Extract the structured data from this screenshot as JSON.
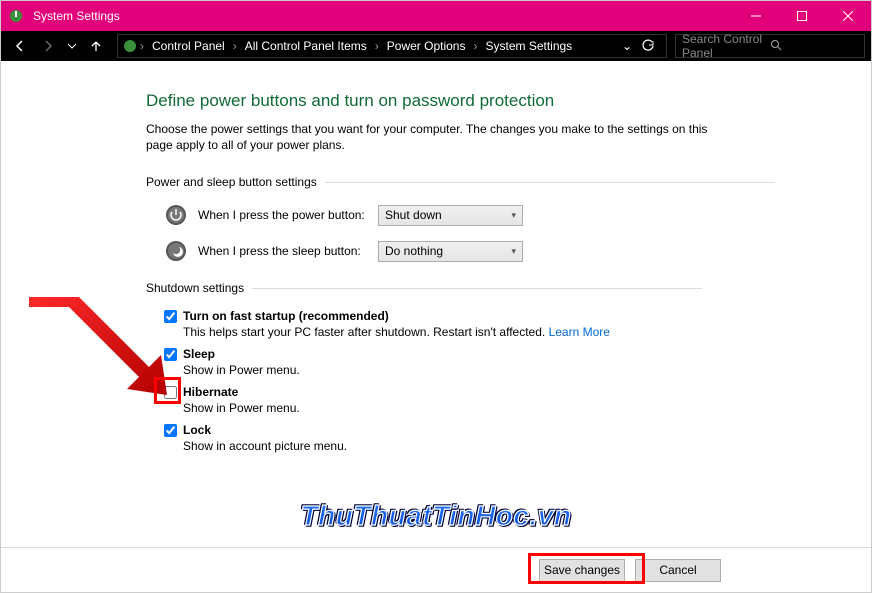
{
  "window": {
    "title": "System Settings"
  },
  "breadcrumbs": {
    "items": [
      "Control Panel",
      "All Control Panel Items",
      "Power Options",
      "System Settings"
    ]
  },
  "search": {
    "placeholder": "Search Control Panel"
  },
  "page": {
    "title": "Define power buttons and turn on password protection",
    "desc": "Choose the power settings that you want for your computer. The changes you make to the settings on this page apply to all of your power plans."
  },
  "sections": {
    "buttons_header": "Power and sleep button settings",
    "shutdown_header": "Shutdown settings"
  },
  "rows": {
    "power": {
      "label": "When I press the power button:",
      "value": "Shut down"
    },
    "sleep": {
      "label": "When I press the sleep button:",
      "value": "Do nothing"
    }
  },
  "shutdown": {
    "fast": {
      "label": "Turn on fast startup (recommended)",
      "desc_pre": "This helps start your PC faster after shutdown. Restart isn't affected. ",
      "link": "Learn More",
      "checked": true
    },
    "sleep": {
      "label": "Sleep",
      "desc": "Show in Power menu.",
      "checked": true
    },
    "hibernate": {
      "label": "Hibernate",
      "desc": "Show in Power menu.",
      "checked": false
    },
    "lock": {
      "label": "Lock",
      "desc": "Show in account picture menu.",
      "checked": true
    }
  },
  "footer": {
    "save": "Save changes",
    "cancel": "Cancel"
  },
  "watermark": "ThuThuatTinHoc.vn"
}
